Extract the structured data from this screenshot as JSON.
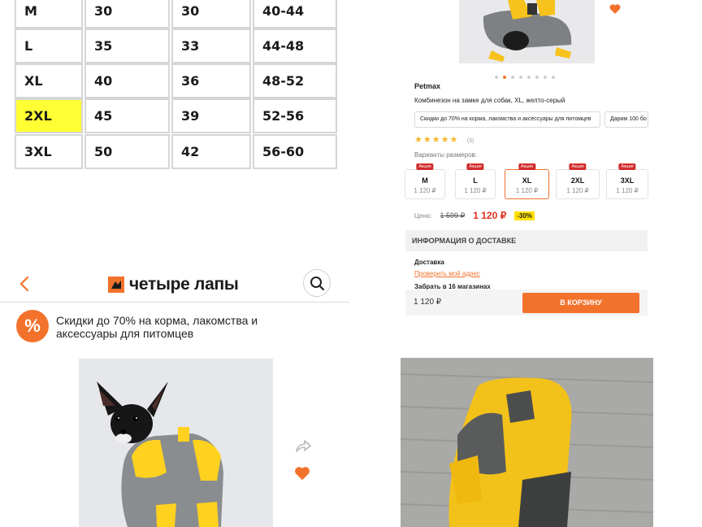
{
  "size_table": {
    "rows": [
      [
        "M",
        "30",
        "30",
        "40-44"
      ],
      [
        "L",
        "35",
        "33",
        "44-48"
      ],
      [
        "XL",
        "40",
        "36",
        "48-52"
      ],
      [
        "2XL",
        "45",
        "39",
        "52-56"
      ],
      [
        "3XL",
        "50",
        "42",
        "56-60"
      ]
    ],
    "highlighted_row_label": "2XL",
    "highlight_color": "#ffff33"
  },
  "product": {
    "brand": "Petmax",
    "title": "Комбинезон на замке для собак, XL, желто-серый",
    "chips": [
      "Скидки до 70% на корма, лакомства и аксессуары для питомцев",
      "Дарим 100 бо"
    ],
    "rating_count": "(3)",
    "stars": 5,
    "sizes_label": "Варианты размеров:",
    "sizes": [
      {
        "name": "M",
        "price": "1 120 ₽",
        "promo": "Акция"
      },
      {
        "name": "L",
        "price": "1 120 ₽",
        "promo": "Акция"
      },
      {
        "name": "XL",
        "price": "1 120 ₽",
        "promo": "Акция"
      },
      {
        "name": "2XL",
        "price": "1 120 ₽",
        "promo": "Акция"
      },
      {
        "name": "3XL",
        "price": "1 120 ₽",
        "promo": "Акция"
      }
    ],
    "selected_size": "XL",
    "price_label": "Цена:",
    "old_price": "1 599 ₽",
    "new_price": "1 120 ₽",
    "discount": "-30%",
    "delivery_heading": "ИНФОРМАЦИЯ О ДОСТАВКЕ",
    "delivery_label": "Доставка",
    "check_address": "Проверить мой адрес",
    "pickup": "Забрать в 16 магазинах",
    "bottom_price": "1 120 ₽",
    "cart_button": "В КОРЗИНУ",
    "accent_color": "#f2722c",
    "heart_icon": "heart-icon"
  },
  "app_header": {
    "logo_text": "четыре лапы",
    "back_icon": "chevron-left-icon",
    "search_icon": "search-icon"
  },
  "promo_banner": {
    "badge": "%",
    "text": "Скидки до 70% на корма, лакомства и аксессуары для питомцев"
  },
  "bottom_photo": {
    "share_icon": "share-icon",
    "heart_icon": "heart-icon"
  }
}
